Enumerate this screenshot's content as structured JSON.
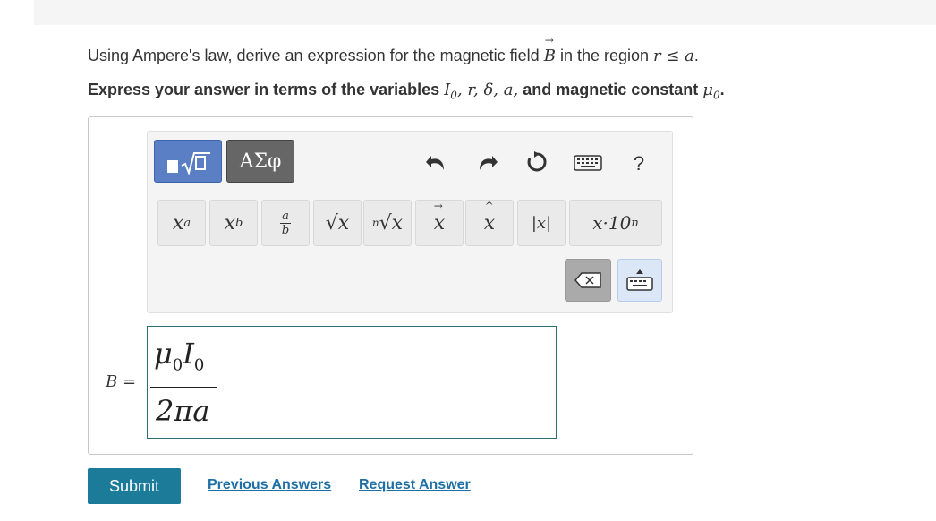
{
  "question": {
    "prefix": "Using Ampere's law, derive an expression for the magnetic field ",
    "field_symbol": "B",
    "middle": " in the region ",
    "condition": "r ≤ a",
    "suffix": "."
  },
  "instruction": {
    "prefix": "Express your answer in terms of the variables ",
    "variables": "I",
    "sub0": "0",
    "rest": ", r, δ, a,",
    "middle": " and magnetic constant ",
    "constant": "μ",
    "const_sub": "0",
    "suffix": "."
  },
  "toolbar": {
    "greek_label": "ΑΣφ",
    "help_label": "?",
    "keys": {
      "power": "x",
      "power_sup": "a",
      "subscript": "x",
      "subscript_sub": "b",
      "frac_top": "a",
      "frac_bottom": "b",
      "sqrt": "√x",
      "nroot_n": "n",
      "nroot": "√x",
      "vector": "x",
      "hat": "x",
      "abs": "|x|",
      "sci": "x·10",
      "sci_sup": "n"
    }
  },
  "answer": {
    "label": "B =",
    "numerator": "μ",
    "num_sub1": "0",
    "numerator2": "I",
    "num_sub2": "0",
    "denominator": "2πa"
  },
  "actions": {
    "submit": "Submit",
    "previous": "Previous Answers",
    "request": "Request Answer"
  }
}
